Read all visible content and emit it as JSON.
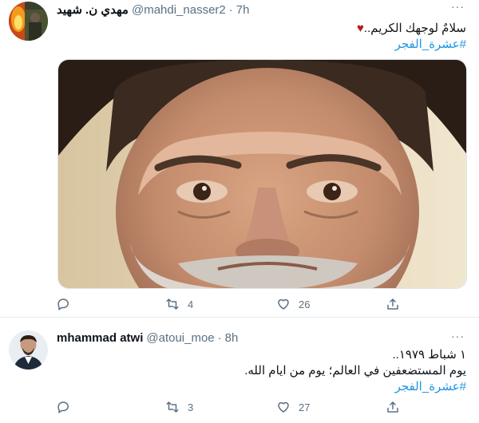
{
  "tweets": [
    {
      "name": "مهدي ن. شهيد",
      "handle": "@mahdi_nasser2",
      "time": "7h",
      "text_line1": "سلامٌ لوجهك الكريم..",
      "hashtag": "#عشرة_الفجر",
      "replies": "",
      "retweets": "4",
      "likes": "26"
    },
    {
      "name": "mhammad atwi",
      "handle": "@atoui_moe",
      "time": "8h",
      "text_line1": "١ شباط ١٩٧٩..",
      "text_line2": "يوم المستضعفين في العالم؛ يوم من ايام الله.",
      "hashtag": "#عشرة_الفجر",
      "replies": "",
      "retweets": "3",
      "likes": "27"
    }
  ],
  "colors": {
    "link": "#1b95e0",
    "muted": "#5b7083",
    "heart": "#b71c1c"
  },
  "icons": [
    "more-icon",
    "reply-icon",
    "retweet-icon",
    "like-icon",
    "share-icon",
    "heart-emoji"
  ]
}
